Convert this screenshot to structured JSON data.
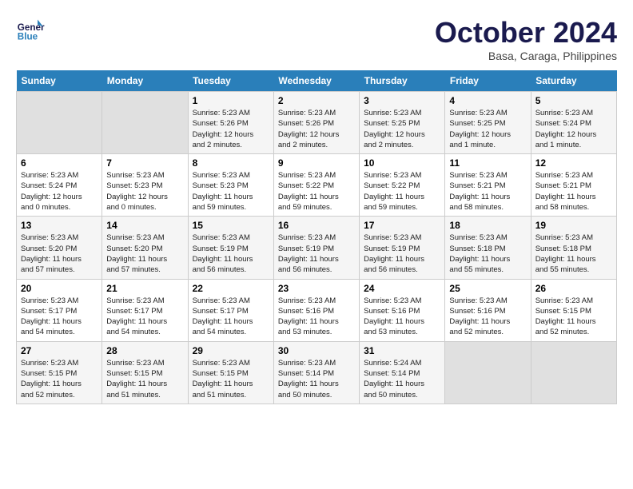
{
  "header": {
    "logo_general": "General",
    "logo_blue": "Blue",
    "month_title": "October 2024",
    "subtitle": "Basa, Caraga, Philippines"
  },
  "weekdays": [
    "Sunday",
    "Monday",
    "Tuesday",
    "Wednesday",
    "Thursday",
    "Friday",
    "Saturday"
  ],
  "weeks": [
    [
      {
        "day": "",
        "detail": ""
      },
      {
        "day": "",
        "detail": ""
      },
      {
        "day": "1",
        "detail": "Sunrise: 5:23 AM\nSunset: 5:26 PM\nDaylight: 12 hours\nand 2 minutes."
      },
      {
        "day": "2",
        "detail": "Sunrise: 5:23 AM\nSunset: 5:26 PM\nDaylight: 12 hours\nand 2 minutes."
      },
      {
        "day": "3",
        "detail": "Sunrise: 5:23 AM\nSunset: 5:25 PM\nDaylight: 12 hours\nand 2 minutes."
      },
      {
        "day": "4",
        "detail": "Sunrise: 5:23 AM\nSunset: 5:25 PM\nDaylight: 12 hours\nand 1 minute."
      },
      {
        "day": "5",
        "detail": "Sunrise: 5:23 AM\nSunset: 5:24 PM\nDaylight: 12 hours\nand 1 minute."
      }
    ],
    [
      {
        "day": "6",
        "detail": "Sunrise: 5:23 AM\nSunset: 5:24 PM\nDaylight: 12 hours\nand 0 minutes."
      },
      {
        "day": "7",
        "detail": "Sunrise: 5:23 AM\nSunset: 5:23 PM\nDaylight: 12 hours\nand 0 minutes."
      },
      {
        "day": "8",
        "detail": "Sunrise: 5:23 AM\nSunset: 5:23 PM\nDaylight: 11 hours\nand 59 minutes."
      },
      {
        "day": "9",
        "detail": "Sunrise: 5:23 AM\nSunset: 5:22 PM\nDaylight: 11 hours\nand 59 minutes."
      },
      {
        "day": "10",
        "detail": "Sunrise: 5:23 AM\nSunset: 5:22 PM\nDaylight: 11 hours\nand 59 minutes."
      },
      {
        "day": "11",
        "detail": "Sunrise: 5:23 AM\nSunset: 5:21 PM\nDaylight: 11 hours\nand 58 minutes."
      },
      {
        "day": "12",
        "detail": "Sunrise: 5:23 AM\nSunset: 5:21 PM\nDaylight: 11 hours\nand 58 minutes."
      }
    ],
    [
      {
        "day": "13",
        "detail": "Sunrise: 5:23 AM\nSunset: 5:20 PM\nDaylight: 11 hours\nand 57 minutes."
      },
      {
        "day": "14",
        "detail": "Sunrise: 5:23 AM\nSunset: 5:20 PM\nDaylight: 11 hours\nand 57 minutes."
      },
      {
        "day": "15",
        "detail": "Sunrise: 5:23 AM\nSunset: 5:19 PM\nDaylight: 11 hours\nand 56 minutes."
      },
      {
        "day": "16",
        "detail": "Sunrise: 5:23 AM\nSunset: 5:19 PM\nDaylight: 11 hours\nand 56 minutes."
      },
      {
        "day": "17",
        "detail": "Sunrise: 5:23 AM\nSunset: 5:19 PM\nDaylight: 11 hours\nand 56 minutes."
      },
      {
        "day": "18",
        "detail": "Sunrise: 5:23 AM\nSunset: 5:18 PM\nDaylight: 11 hours\nand 55 minutes."
      },
      {
        "day": "19",
        "detail": "Sunrise: 5:23 AM\nSunset: 5:18 PM\nDaylight: 11 hours\nand 55 minutes."
      }
    ],
    [
      {
        "day": "20",
        "detail": "Sunrise: 5:23 AM\nSunset: 5:17 PM\nDaylight: 11 hours\nand 54 minutes."
      },
      {
        "day": "21",
        "detail": "Sunrise: 5:23 AM\nSunset: 5:17 PM\nDaylight: 11 hours\nand 54 minutes."
      },
      {
        "day": "22",
        "detail": "Sunrise: 5:23 AM\nSunset: 5:17 PM\nDaylight: 11 hours\nand 54 minutes."
      },
      {
        "day": "23",
        "detail": "Sunrise: 5:23 AM\nSunset: 5:16 PM\nDaylight: 11 hours\nand 53 minutes."
      },
      {
        "day": "24",
        "detail": "Sunrise: 5:23 AM\nSunset: 5:16 PM\nDaylight: 11 hours\nand 53 minutes."
      },
      {
        "day": "25",
        "detail": "Sunrise: 5:23 AM\nSunset: 5:16 PM\nDaylight: 11 hours\nand 52 minutes."
      },
      {
        "day": "26",
        "detail": "Sunrise: 5:23 AM\nSunset: 5:15 PM\nDaylight: 11 hours\nand 52 minutes."
      }
    ],
    [
      {
        "day": "27",
        "detail": "Sunrise: 5:23 AM\nSunset: 5:15 PM\nDaylight: 11 hours\nand 52 minutes."
      },
      {
        "day": "28",
        "detail": "Sunrise: 5:23 AM\nSunset: 5:15 PM\nDaylight: 11 hours\nand 51 minutes."
      },
      {
        "day": "29",
        "detail": "Sunrise: 5:23 AM\nSunset: 5:15 PM\nDaylight: 11 hours\nand 51 minutes."
      },
      {
        "day": "30",
        "detail": "Sunrise: 5:23 AM\nSunset: 5:14 PM\nDaylight: 11 hours\nand 50 minutes."
      },
      {
        "day": "31",
        "detail": "Sunrise: 5:24 AM\nSunset: 5:14 PM\nDaylight: 11 hours\nand 50 minutes."
      },
      {
        "day": "",
        "detail": ""
      },
      {
        "day": "",
        "detail": ""
      }
    ]
  ]
}
